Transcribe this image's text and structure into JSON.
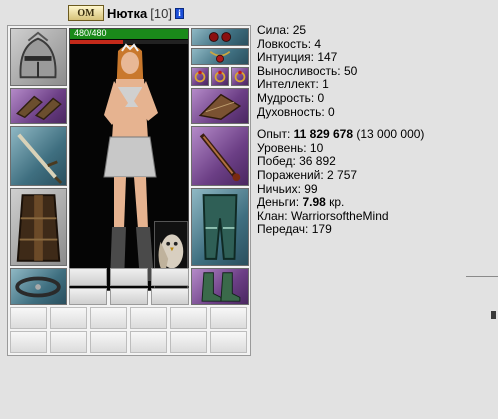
{
  "header": {
    "clan_emblem_text": "ОМ",
    "name": "Нютка",
    "level": "[10]",
    "info_icon": "i"
  },
  "character": {
    "hp_text": "480/480",
    "hp_fill": 1.0,
    "mana_fill": 0.45
  },
  "stats": {
    "strength": "Сила: 25",
    "agility": "Ловкость: 4",
    "intuition": "Интуиция: 147",
    "endurance": "Выносливость: 50",
    "intellect": "Интеллект: 1",
    "wisdom": "Мудрость: 0",
    "spirituality": "Духовность: 0"
  },
  "info": {
    "exp_label": "Опыт: ",
    "exp_value": "11 829 678",
    "exp_next": " (13 000 000)",
    "level": "Уровень: 10",
    "wins": "Побед: 36 892",
    "losses": "Поражений: 2 757",
    "draws": "Ничьих: 99",
    "money_label": "Деньги: ",
    "money_value": "7.98",
    "money_unit": " кр.",
    "clan": "Клан: WarriorsoftheMind",
    "transfers": "Передач: 179"
  },
  "colors": {
    "hp": "#1a8a1a",
    "mana": "#c42a1a",
    "panel_bg": "#f3f3f3",
    "page_bg": "#e2e2e2"
  },
  "icons": {
    "clan": "clan-emblem-icon",
    "info": "info-icon",
    "helmet": "helmet-icon",
    "bracers": "bracers-icon",
    "sword": "sword-icon",
    "armor": "armor-icon",
    "belt": "belt-icon",
    "earrings": "earrings-icon",
    "amulet": "amulet-icon",
    "rings": "rings-icon",
    "gloves": "gloves-icon",
    "weapon": "dagger-icon",
    "leggings": "leggings-icon",
    "boots": "boots-icon",
    "owl": "owl-pet-icon"
  }
}
